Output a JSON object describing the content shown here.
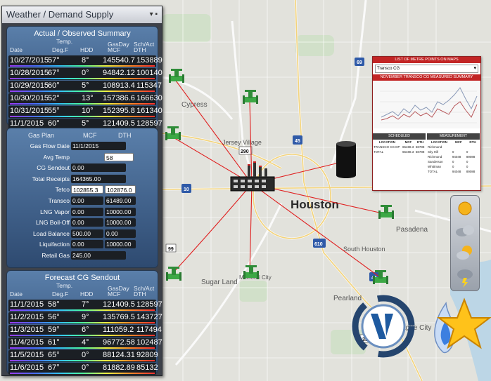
{
  "panel": {
    "title": "Weather / Demand Supply",
    "actual": {
      "title": "Actual / Observed Summary",
      "headers": {
        "date": "Date",
        "temp_top": "Temp.",
        "temp": "Deg.F",
        "hdd": "HDD",
        "gasday_top": "GasDay",
        "gasday": "MCF",
        "schact_top": "Sch/Act",
        "schact": "DTH"
      },
      "rows": [
        {
          "date": "10/27/2015",
          "temp": "57°",
          "hdd": "8°",
          "mcf": "145540.7",
          "dth": "153889"
        },
        {
          "date": "10/28/2015",
          "temp": "67°",
          "hdd": "0°",
          "mcf": "94842.12",
          "dth": "100140"
        },
        {
          "date": "10/29/2015",
          "temp": "60°",
          "hdd": "5°",
          "mcf": "108913.4",
          "dth": "115347"
        },
        {
          "date": "10/30/2015",
          "temp": "52°",
          "hdd": "13°",
          "mcf": "157386.6",
          "dth": "166630"
        },
        {
          "date": "10/31/2015",
          "temp": "55°",
          "hdd": "10°",
          "mcf": "152395.8",
          "dth": "161340"
        },
        {
          "date": "11/1/2015",
          "temp": "60°",
          "hdd": "5°",
          "mcf": "121409.5",
          "dth": "128597"
        }
      ]
    },
    "gasplan": {
      "headers": {
        "label": "Gas Plan",
        "mcf": "MCF",
        "dth": "DTH"
      },
      "rows": [
        {
          "label": "Gas Flow Date",
          "v1": "11/1/2015",
          "v2": "",
          "white1": false
        },
        {
          "label": "Avg Temp",
          "v1": "",
          "v2": "58",
          "white2": true
        },
        {
          "label": "CG Sendout",
          "v1": "0.00",
          "v2": ""
        },
        {
          "label": "Total Receipts",
          "v1": "164365.00",
          "v2": ""
        },
        {
          "label": "Tetco",
          "v1": "102855.3",
          "v2": "102876.0",
          "white1": true,
          "white2": true
        },
        {
          "label": "Transco",
          "v1": "0.00",
          "v2": "61489.00"
        },
        {
          "label": "LNG Vapor",
          "v1": "0.00",
          "v2": "10000.00"
        },
        {
          "label": "LNG Boil-Off",
          "v1": "0.00",
          "v2": "10000.00"
        },
        {
          "label": "Load Balance",
          "v1": "500.00",
          "v2": "0.00"
        },
        {
          "label": "Liquifaction",
          "v1": "0.00",
          "v2": "10000.00"
        },
        {
          "label": "Retail Gas",
          "v1": "245.00",
          "v2": ""
        }
      ]
    },
    "forecast": {
      "title": "Forecast CG Sendout",
      "headers": {
        "date": "Date",
        "temp_top": "Temp.",
        "temp": "Deg.F",
        "hdd": "HDD",
        "gasday_top": "GasDay",
        "gasday": "MCF",
        "schact_top": "Sch/Act",
        "schact": "DTH"
      },
      "rows": [
        {
          "date": "11/1/2015",
          "temp": "58°",
          "hdd": "7°",
          "mcf": "121409.5",
          "dth": "128597"
        },
        {
          "date": "11/2/2015",
          "temp": "56°",
          "hdd": "9°",
          "mcf": "135769.5",
          "dth": "143727"
        },
        {
          "date": "11/3/2015",
          "temp": "59°",
          "hdd": "6°",
          "mcf": "111059.2",
          "dth": "117494"
        },
        {
          "date": "11/4/2015",
          "temp": "61°",
          "hdd": "4°",
          "mcf": "96772.58",
          "dth": "102487"
        },
        {
          "date": "11/5/2015",
          "temp": "65°",
          "hdd": "0°",
          "mcf": "88124.31",
          "dth": "92809"
        },
        {
          "date": "11/6/2015",
          "temp": "67°",
          "hdd": "0°",
          "mcf": "81882.89",
          "dth": "85132"
        }
      ]
    }
  },
  "map": {
    "city_label": "Houston",
    "place_labels": [
      "Cypress",
      "Jersey Village",
      "Pasadena",
      "South Houston",
      "Sugar Land",
      "Missouri City",
      "Pearland",
      "League City"
    ],
    "road_shields": [
      "69",
      "290",
      "45",
      "10",
      "10",
      "99",
      "610",
      "45",
      "35"
    ],
    "pipe_color": "#e02020"
  },
  "summary": {
    "title": "LIST OF METRE POINTS ON MAPS",
    "select_value": "Transco CG",
    "chart_title": "NOVEMBER TRANSCO CG MEASURED SUMMARY",
    "scheduled_hdr": "SCHEDULED",
    "measurement_hdr": "MEASUREMENT",
    "sched_cols": [
      "LOCATION",
      "MCF",
      "DTH"
    ],
    "sched_rows": [
      [
        "TRANSCO CG DP",
        "65488.3",
        "58788"
      ],
      [
        "TOTAL",
        "65488.3",
        "58788"
      ]
    ],
    "meas_cols": [
      "LOCATION",
      "MCF",
      "DTH"
    ],
    "meas_rows": [
      [
        "Richmond",
        "",
        ""
      ],
      [
        "Sky Hill",
        "0",
        "0"
      ],
      [
        "Richmond",
        "94048",
        "89088"
      ],
      [
        "Sanderson",
        "0",
        "0"
      ],
      [
        "Whittman",
        "0",
        "0"
      ],
      [
        "TOTAL",
        "94048",
        "89088"
      ]
    ]
  },
  "weather": {
    "icons": [
      "sun-icon",
      "cloudy-icon",
      "partly-cloudy-icon",
      "thunderstorm-icon"
    ]
  }
}
